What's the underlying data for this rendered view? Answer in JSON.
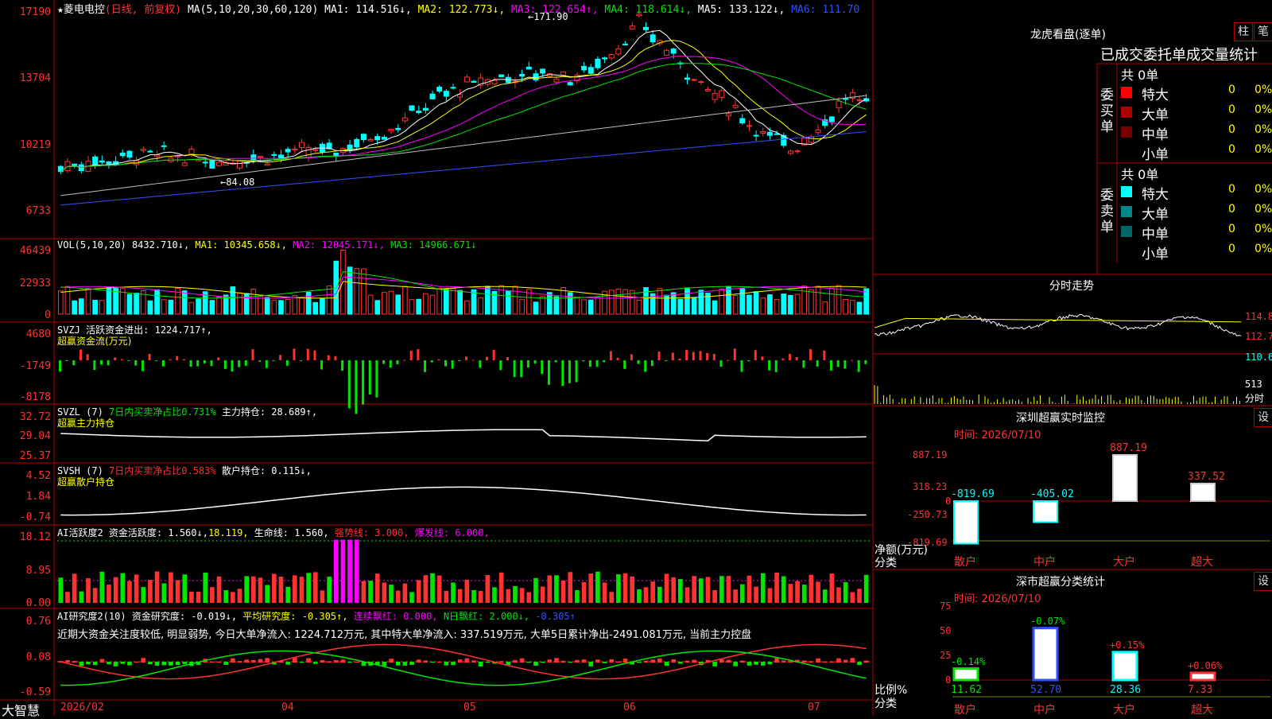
{
  "main_header": {
    "name": "★菱电电控",
    "mode": "(日线, 前复权)",
    "ma_label": "MA(5,10,20,30,60,120)",
    "ma1": "MA1: 114.516↓,",
    "ma2": "MA2: 122.773↓,",
    "ma3": "MA3: 122.654↑,",
    "ma4": "MA4: 118.614↓,",
    "ma5": "MA5: 133.122↓,",
    "ma6": "MA6: 111.70"
  },
  "main_y": [
    "17190",
    "13704",
    "10219",
    "6733"
  ],
  "annotations": {
    "high": "171.90",
    "low": "84.08"
  },
  "vol_header": {
    "label": "VOL(5,10,20)",
    "v": "8432.710↓,",
    "ma1": "MA1: 10345.658↓,",
    "ma2": "MA2: 12045.171↓,",
    "ma3": "MA3: 14966.671↓"
  },
  "vol_y": [
    "46439",
    "22933",
    "0"
  ],
  "svzj_header": {
    "label": "SVZJ",
    "t1": "活跃资金进出: 1224.717↑,",
    "t2": "超赢资金流(万元)"
  },
  "svzj_y": [
    "4680",
    "-1749",
    "-8178"
  ],
  "svzl_header": {
    "label": "SVZL (7)",
    "t1": "7日内买卖净占比0.731%",
    "t2": "主力持仓: 28.689↑,",
    "t3": "超赢主力持仓"
  },
  "svzl_y": [
    "32.72",
    "29.04",
    "25.37"
  ],
  "svsh_header": {
    "label": "SVSH (7)",
    "t1": "7日内买卖净占比0.583%",
    "t2": "散户持仓: 0.115↓,",
    "t3": "超赢散户持仓"
  },
  "svsh_y": [
    "4.52",
    "1.84",
    "-0.74"
  ],
  "ai1_header": {
    "label": "AI活跃度2",
    "t1": "资金活跃度: 1.560↓,",
    "t2": "18.119,",
    "t3": "生命线: 1.560,",
    "t4": "强势线: 3.000,",
    "t5": "爆发线: 6.000,"
  },
  "ai1_y": [
    "18.12",
    "8.95",
    "0.00"
  ],
  "ai2_header": {
    "label": "AI研究度2(10)",
    "t1": "资金研究度: -0.019↓,",
    "t2": "平均研究度: -0.305↑,",
    "t3": "连续飘红: 0.000,",
    "t4": "N日飘红: 2.000↓,",
    "t5": "-0.305↑"
  },
  "ai2_text": "近期大资金关注度较低, 明显弱势, 今日大单净流入: 1224.712万元, 其中特大单净流入: 337.519万元, 大单5日累计净出-2491.081万元, 当前主力控盘",
  "ai2_y": [
    "0.76",
    "0.08",
    "-0.59"
  ],
  "x_axis": {
    "brand": "大智慧",
    "labels": [
      "2026/02",
      "04",
      "05",
      "06",
      "07"
    ]
  },
  "longhu": {
    "title": "龙虎看盘(逐单)",
    "btn1": "柱",
    "btn2": "笔",
    "subtitle": "已成交委托单成交量统计",
    "buy_side": "委买单",
    "sell_side": "委卖单",
    "buy_total": "共 0单",
    "sell_total": "共 0单",
    "buy_rows": [
      {
        "label": "特大",
        "n": "0",
        "p": "0%",
        "color": "#ff0000"
      },
      {
        "label": "大单",
        "n": "0",
        "p": "0%",
        "color": "#aa0000"
      },
      {
        "label": "中单",
        "n": "0",
        "p": "0%",
        "color": "#770000"
      },
      {
        "label": "小单",
        "n": "0",
        "p": "0%",
        "color": ""
      }
    ],
    "sell_rows": [
      {
        "label": "特大",
        "n": "0",
        "p": "0%",
        "color": "#00ffff"
      },
      {
        "label": "大单",
        "n": "0",
        "p": "0%",
        "color": "#008888"
      },
      {
        "label": "中单",
        "n": "0",
        "p": "0%",
        "color": "#006666"
      },
      {
        "label": "小单",
        "n": "0",
        "p": "0%",
        "color": ""
      }
    ]
  },
  "fenshi": {
    "title": "分时走势",
    "y": [
      "114.8",
      "112.7",
      "110.6"
    ],
    "vol": "513",
    "vol_unit": "分时"
  },
  "sz_monitor": {
    "title": "深圳超赢实时监控",
    "btn": "设",
    "time": "时间: 2026/07/10",
    "y": [
      "887.19",
      "318.23",
      "0",
      "-250.73",
      "-819.69"
    ],
    "unit": "净额(万元)",
    "cat_label": "分类",
    "cats": [
      "散户",
      "中户",
      "大户",
      "超大"
    ],
    "values": [
      -819.69,
      -405.02,
      887.19,
      337.52
    ],
    "labels": [
      "-819.69",
      "-405.02",
      "887.19",
      "337.52"
    ]
  },
  "sz_stats": {
    "title": "深市超赢分类统计",
    "btn": "设",
    "time": "时间: 2026/07/10",
    "y": [
      "75",
      "50",
      "25",
      "0"
    ],
    "unit": "比例%",
    "cat_label": "分类",
    "cats": [
      "散户",
      "中户",
      "大户",
      "超大"
    ],
    "values": [
      11.62,
      52.7,
      28.36,
      7.33
    ],
    "vlabels": [
      "11.62",
      "52.70",
      "28.36",
      "7.33"
    ],
    "changes": [
      "-0.14%",
      "-0.07%",
      "+0.15%",
      "+0.06%"
    ]
  },
  "colors": {
    "up": "#ff3232",
    "down": "#00ffff",
    "grid": "#b00000"
  }
}
